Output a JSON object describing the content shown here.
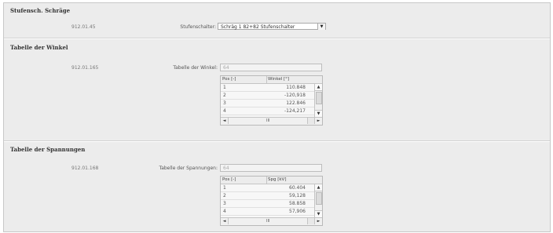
{
  "section1": {
    "title": "Stufensch. Schräge",
    "code": "912.01.45",
    "label": "Stufenschalter:",
    "select_value": "Schräg 1 82+82 Stufenschalter",
    "select_arrow": "▼"
  },
  "section2": {
    "title": "Tabelle der Winkel",
    "code": "912.01.165",
    "label": "Tabelle der Winkel:",
    "input_value": "64",
    "table": {
      "col1": "Pos [-]",
      "col2": "Winkel [°]",
      "rows": [
        {
          "pos": "1",
          "val": "110.848"
        },
        {
          "pos": "2",
          "val": "-120,918"
        },
        {
          "pos": "3",
          "val": "122.846"
        },
        {
          "pos": "4",
          "val": "-124,217"
        }
      ]
    }
  },
  "section3": {
    "title": "Tabelle der Spannungen",
    "code": "912.01.168",
    "label": "Tabelle der Spannungen:",
    "input_value": "64",
    "table": {
      "col1": "Pos [-]",
      "col2": "Spg [kV]",
      "rows": [
        {
          "pos": "1",
          "val": "60.404"
        },
        {
          "pos": "2",
          "val": "59,128"
        },
        {
          "pos": "3",
          "val": "58.858"
        },
        {
          "pos": "4",
          "val": "57,906"
        }
      ]
    }
  },
  "scroll_glyphs": {
    "up": "▲",
    "down": "▼",
    "left": "◄",
    "right": "►",
    "mid": "III"
  }
}
